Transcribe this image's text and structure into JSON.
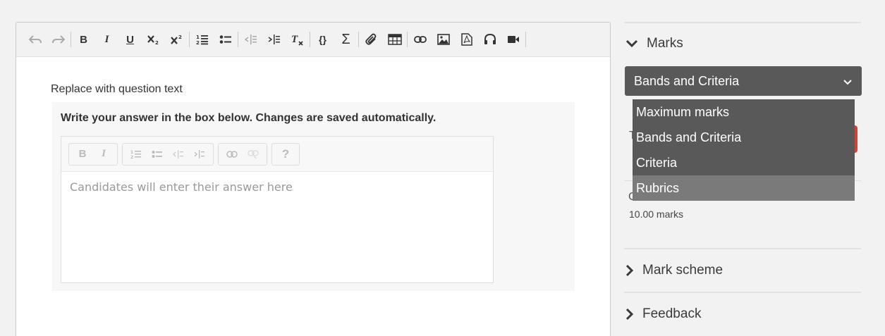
{
  "editor": {
    "question_label": "Replace with question text",
    "answer_instructions": "Write your answer in the box below. Changes are saved automatically.",
    "answer_placeholder": "Candidates will enter their answer here"
  },
  "toolbar": {
    "buttons": [
      "undo-icon",
      "redo-icon",
      "bold-icon",
      "italic-icon",
      "underline-icon",
      "subscript-icon",
      "superscript-icon",
      "numbered-list-icon",
      "bulleted-list-icon",
      "outdent-icon",
      "indent-icon",
      "clear-format-icon",
      "source-code-icon",
      "math-sigma-icon",
      "attachment-icon",
      "table-icon",
      "link-icon",
      "image-icon",
      "pdf-icon",
      "audio-icon",
      "video-icon"
    ],
    "bold_glyph": "B",
    "italic_glyph": "I",
    "underline_glyph": "U",
    "braces_glyph": "{}",
    "sigma_glyph": "Σ"
  },
  "inner_toolbar": {
    "bold_glyph": "B",
    "italic_glyph": "I",
    "help_glyph": "?"
  },
  "sidebar": {
    "marks_label": "Marks",
    "select_value": "Bands and Criteria",
    "dropdown_options": [
      "Maximum marks",
      "Bands and Criteria",
      "Criteria",
      "Rubrics"
    ],
    "highlighted_option": "Rubrics",
    "partial_behind_text": "T",
    "criteria_title": "Criteria 1",
    "criteria_marks": "10.00 marks",
    "mark_scheme_label": "Mark scheme",
    "feedback_label": "Feedback"
  },
  "colors": {
    "select_bg": "#595959",
    "dropdown_highlight": "#7a7a7a",
    "accent_red": "#d14432"
  }
}
